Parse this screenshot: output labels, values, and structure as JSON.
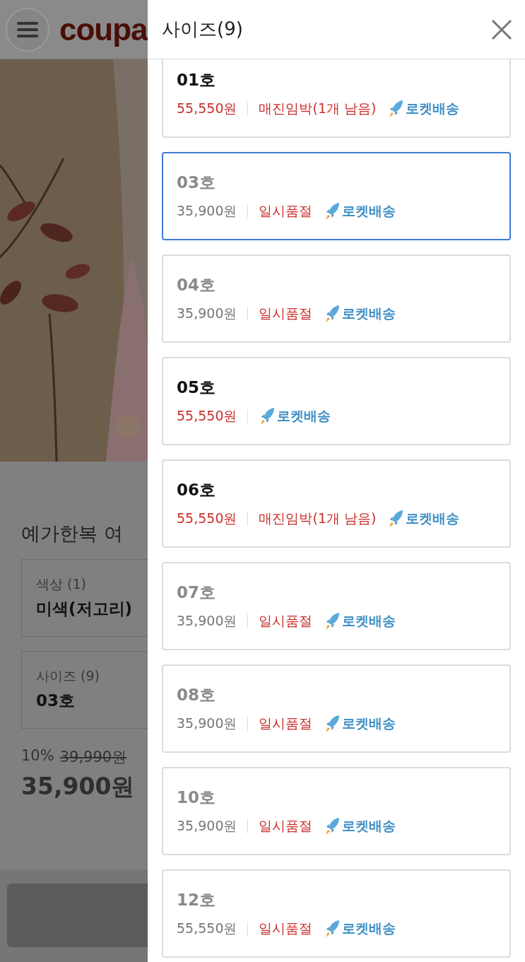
{
  "background_page": {
    "logo": "coupa",
    "product_title": "예가한복 여",
    "options": [
      {
        "label": "색상 (1)",
        "value": "미색(저고리)"
      },
      {
        "label": "사이즈 (9)",
        "value": "03호"
      }
    ],
    "discount": "10%",
    "original_price": "39,990원",
    "price": "35,900원"
  },
  "panel": {
    "title": "사이즈",
    "count": "(9)",
    "items": [
      {
        "name": "01호",
        "price": "55,550원",
        "stock_note": "매진임박(1개 남음)",
        "sold_out": false,
        "selected": false,
        "delivery": "로켓배송"
      },
      {
        "name": "03호",
        "price": "35,900원",
        "stock_note": "일시품절",
        "sold_out": true,
        "selected": true,
        "delivery": "로켓배송"
      },
      {
        "name": "04호",
        "price": "35,900원",
        "stock_note": "일시품절",
        "sold_out": true,
        "selected": false,
        "delivery": "로켓배송"
      },
      {
        "name": "05호",
        "price": "55,550원",
        "sold_out": false,
        "selected": false,
        "delivery": "로켓배송"
      },
      {
        "name": "06호",
        "price": "55,550원",
        "stock_note": "매진임박(1개 남음)",
        "sold_out": false,
        "selected": false,
        "delivery": "로켓배송"
      },
      {
        "name": "07호",
        "price": "35,900원",
        "stock_note": "일시품절",
        "sold_out": true,
        "selected": false,
        "delivery": "로켓배송"
      },
      {
        "name": "08호",
        "price": "35,900원",
        "stock_note": "일시품절",
        "sold_out": true,
        "selected": false,
        "delivery": "로켓배송"
      },
      {
        "name": "10호",
        "price": "35,900원",
        "stock_note": "일시품절",
        "sold_out": true,
        "selected": false,
        "delivery": "로켓배송"
      },
      {
        "name": "12호",
        "price": "55,550원",
        "stock_note": "일시품절",
        "sold_out": true,
        "selected": false,
        "delivery": "로켓배송"
      }
    ]
  }
}
